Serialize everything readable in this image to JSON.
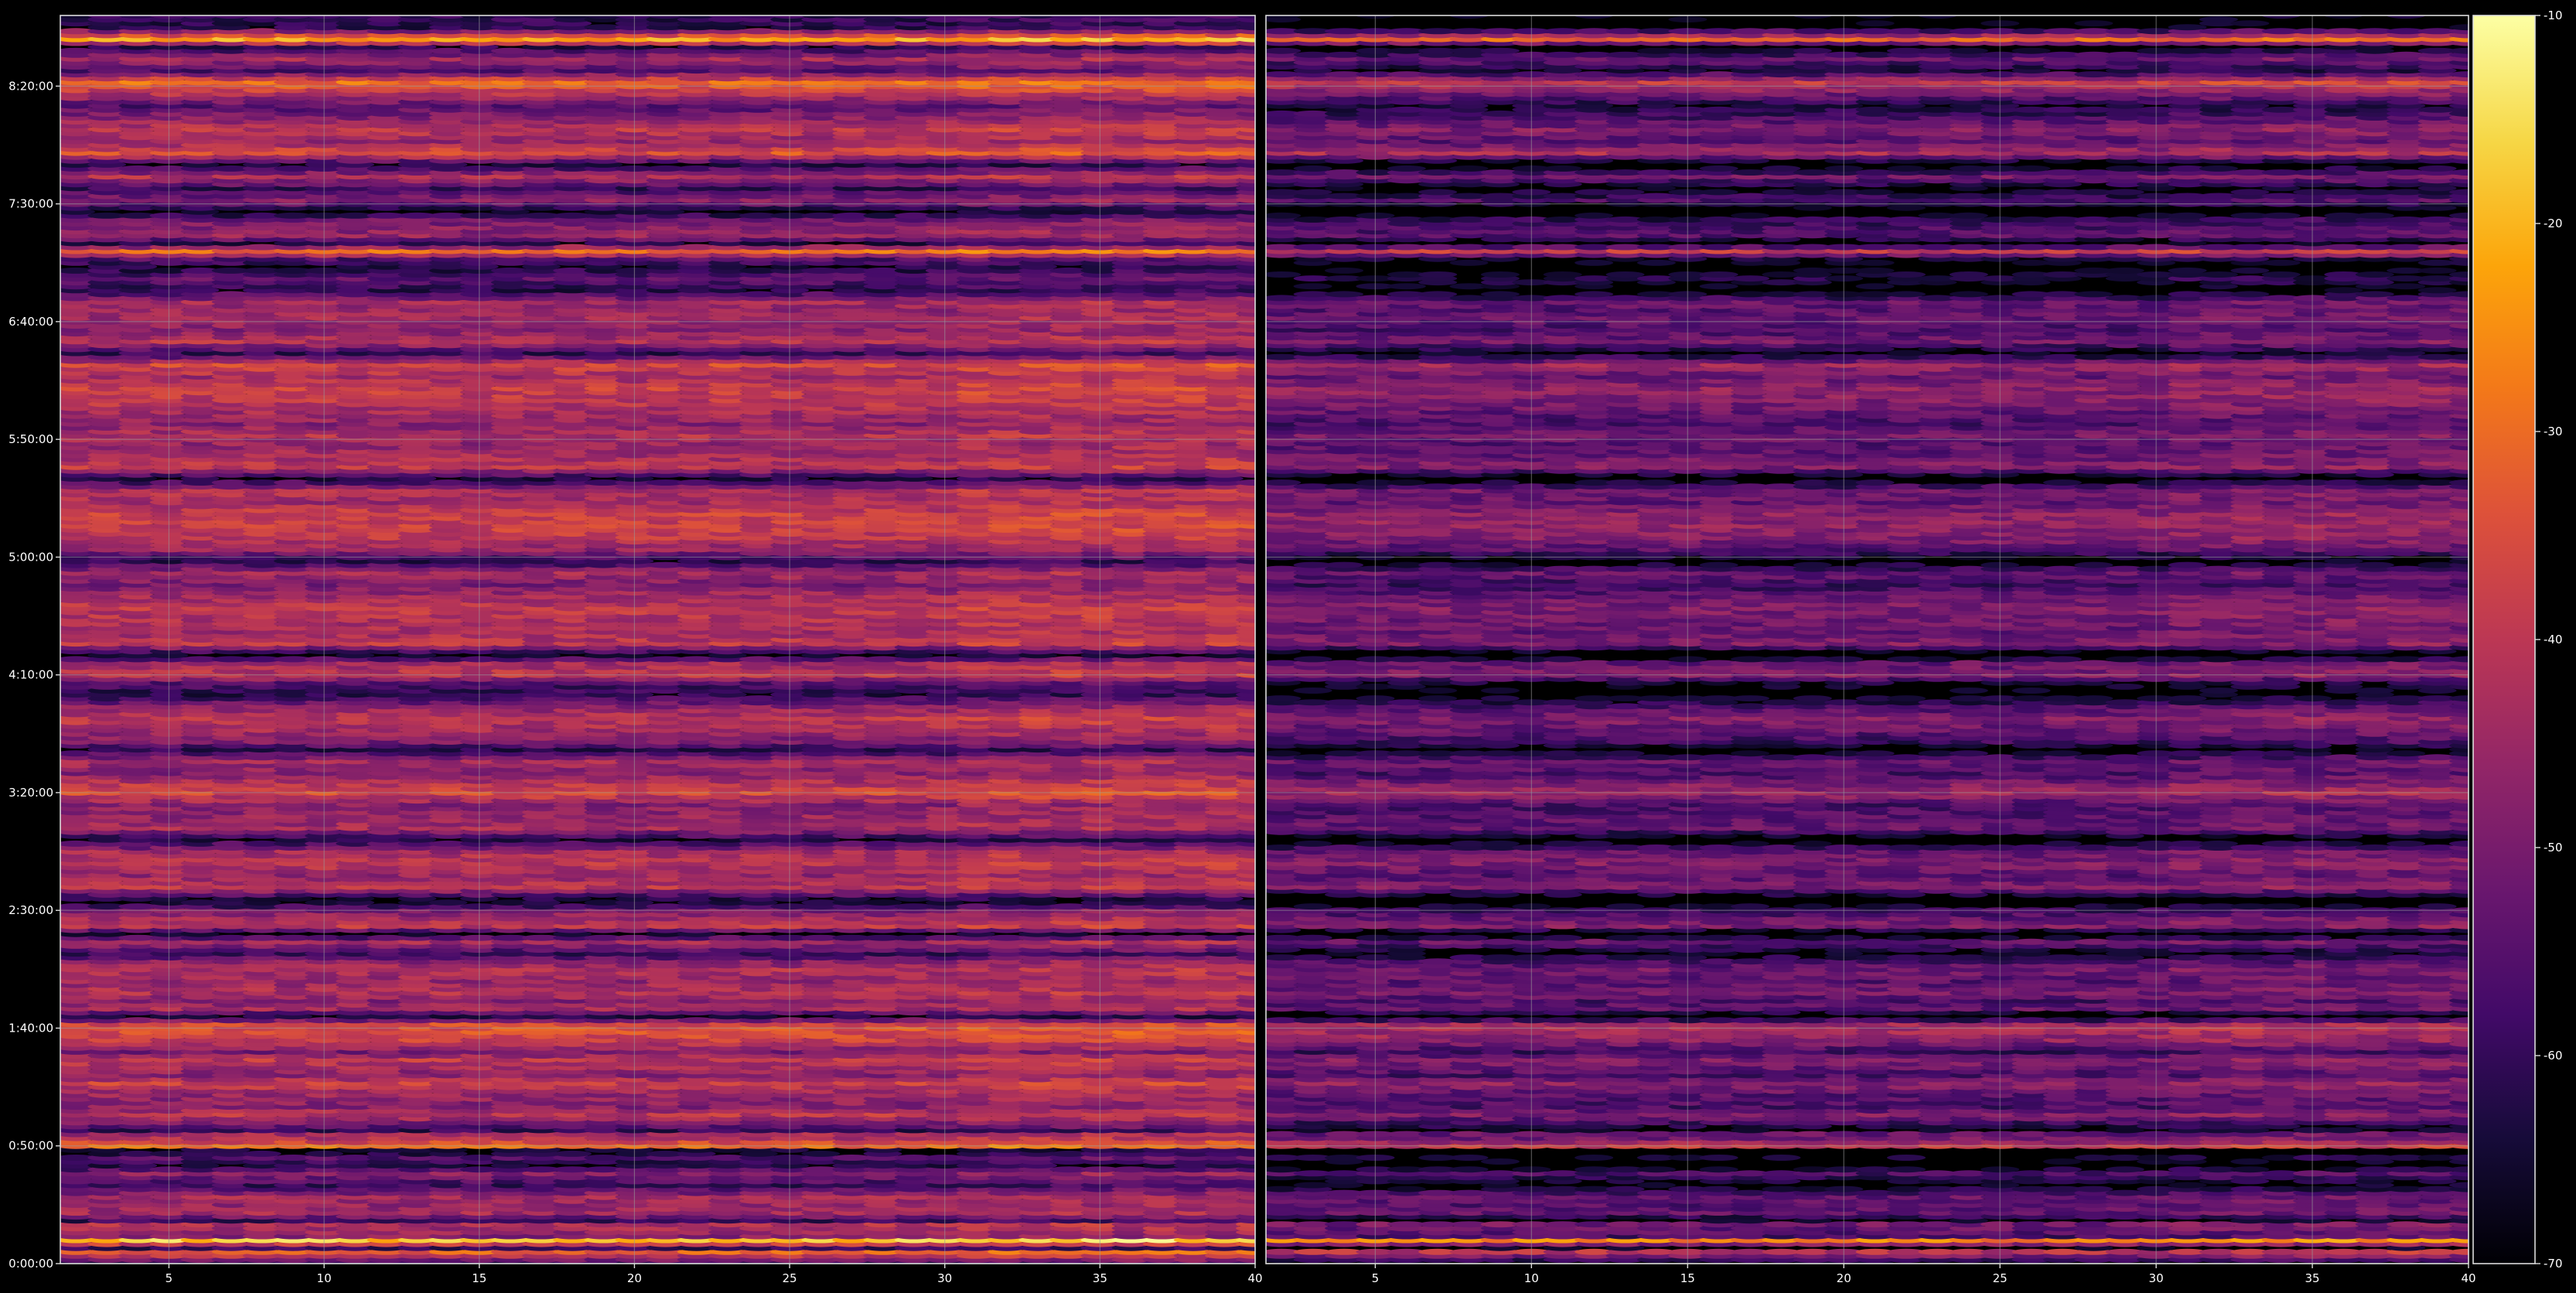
{
  "chart_data": {
    "type": "heatmap",
    "colormap": "inferno",
    "background": "#000000",
    "grid": true,
    "colorbar": {
      "position": "right",
      "range": [
        -70,
        -10
      ],
      "ticks": [
        "-10",
        "-20",
        "-30",
        "-40",
        "-50",
        "-60",
        "-70"
      ]
    },
    "y_axis": {
      "range_seconds": [
        0,
        31800
      ],
      "ticks": [
        {
          "label": "0:00:00",
          "seconds": 0
        },
        {
          "label": "0:50:00",
          "seconds": 3000
        },
        {
          "label": "1:40:00",
          "seconds": 6000
        },
        {
          "label": "2:30:00",
          "seconds": 9000
        },
        {
          "label": "3:20:00",
          "seconds": 12000
        },
        {
          "label": "4:10:00",
          "seconds": 15000
        },
        {
          "label": "5:00:00",
          "seconds": 18000
        },
        {
          "label": "5:50:00",
          "seconds": 21000
        },
        {
          "label": "6:40:00",
          "seconds": 24000
        },
        {
          "label": "7:30:00",
          "seconds": 27000
        },
        {
          "label": "8:20:00",
          "seconds": 30000
        }
      ]
    },
    "panels": [
      {
        "x_range": [
          1.5,
          40
        ],
        "x_ticks": [
          "5",
          "10",
          "15",
          "20",
          "25",
          "30",
          "35",
          "40"
        ],
        "level_offset": 0
      },
      {
        "x_range": [
          1.5,
          40
        ],
        "x_ticks": [
          "5",
          "10",
          "15",
          "20",
          "25",
          "30",
          "35",
          "40"
        ],
        "level_offset": -9
      }
    ],
    "x_columns": [
      2,
      40
    ],
    "row_profile": {
      "seconds": [
        0,
        300,
        400,
        600,
        700,
        1000,
        1100,
        1300,
        1500,
        1700,
        2000,
        2300,
        2500,
        2700,
        2800,
        2900,
        3000,
        3200,
        3300,
        3400,
        3600,
        3800,
        4000,
        4300,
        4600,
        4800,
        5000,
        5200,
        5400,
        5700,
        6000,
        6100,
        6300,
        6500,
        6700,
        6900,
        7200,
        7500,
        7700,
        7900,
        8200,
        8400,
        8600,
        8800,
        9000,
        9200,
        9300,
        9600,
        9900,
        10200,
        10500,
        10800,
        11100,
        11400,
        11700,
        12000,
        12200,
        12500,
        12800,
        13100,
        13300,
        13600,
        13900,
        14200,
        14500,
        14800,
        15000,
        15300,
        15500,
        15800,
        16100,
        16400,
        16700,
        17000,
        17300,
        17600,
        17900,
        18200,
        18500,
        18800,
        19100,
        19400,
        19700,
        20000,
        20300,
        20600,
        20900,
        21100,
        21400,
        21700,
        22000,
        22300,
        22600,
        22900,
        23200,
        23500,
        23800,
        24100,
        24300,
        24500,
        24800,
        25100,
        25400,
        25600,
        25800,
        26000,
        26200,
        26400,
        26600,
        26800,
        27100,
        27400,
        27700,
        28000,
        28300,
        28600,
        28900,
        29200,
        29500,
        29800,
        30100,
        30400,
        30700,
        31000,
        31200,
        31500,
        31800
      ],
      "values": [
        -60,
        -32,
        -60,
        -18,
        -48,
        -42,
        -60,
        -44,
        -46,
        -44,
        -60,
        -48,
        -64,
        -56,
        -64,
        -66,
        -30,
        -42,
        -44,
        -60,
        -50,
        -40,
        -48,
        -46,
        -38,
        -48,
        -44,
        -40,
        -50,
        -38,
        -34,
        -36,
        -64,
        -44,
        -48,
        -42,
        -46,
        -42,
        -48,
        -60,
        -44,
        -68,
        -40,
        -44,
        -50,
        -66,
        -64,
        -40,
        -46,
        -40,
        -44,
        -64,
        -44,
        -46,
        -48,
        -36,
        -40,
        -48,
        -44,
        -62,
        -50,
        -44,
        -40,
        -48,
        -62,
        -56,
        -40,
        -44,
        -68,
        -40,
        -44,
        -42,
        -40,
        -44,
        -50,
        -44,
        -62,
        -46,
        -40,
        -38,
        -38,
        -44,
        -42,
        -64,
        -40,
        -44,
        -46,
        -42,
        -48,
        -44,
        -40,
        -38,
        -44,
        -36,
        -60,
        -42,
        -48,
        -44,
        -46,
        -44,
        -62,
        -54,
        -64,
        -56,
        -30,
        -62,
        -46,
        -48,
        -52,
        -68,
        -48,
        -60,
        -42,
        -64,
        -34,
        -46,
        -40,
        -48,
        -56,
        -42,
        -30,
        -56,
        -44,
        -62,
        -22,
        -62,
        -60
      ]
    }
  }
}
